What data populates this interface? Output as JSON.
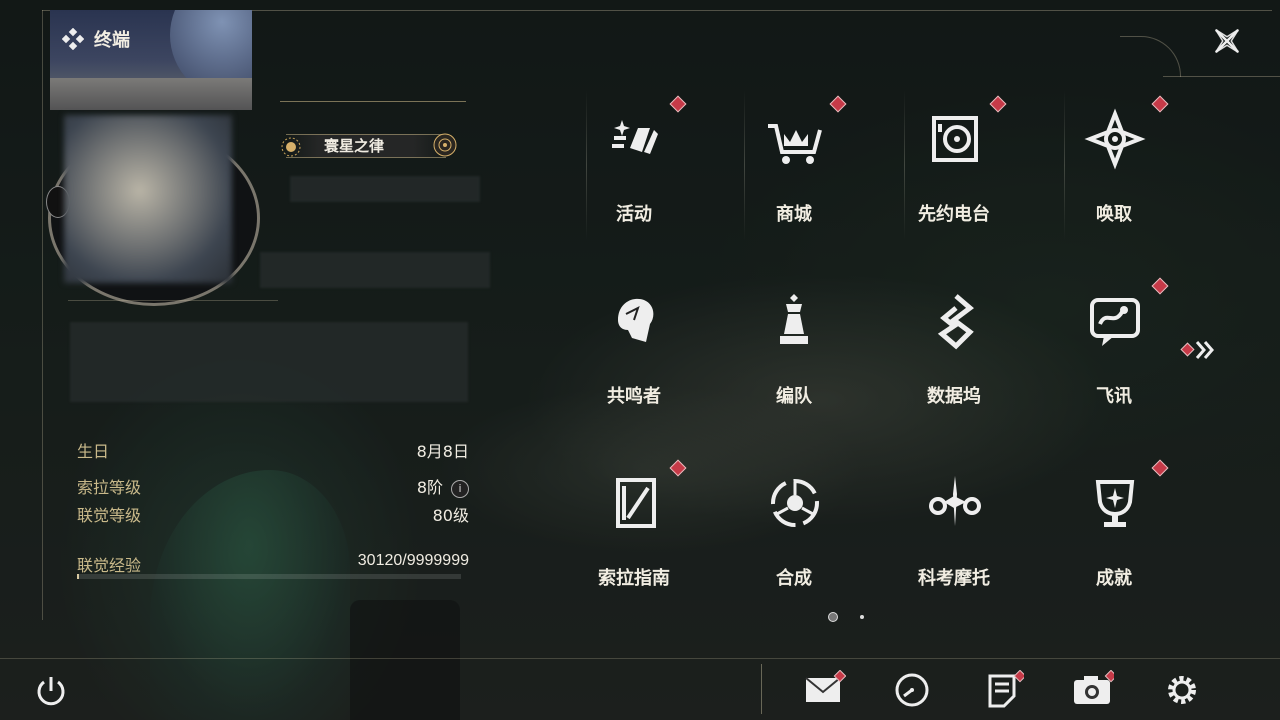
{
  "header": {
    "title": "终端"
  },
  "profile": {
    "title_badge": "寰星之律",
    "stats": [
      {
        "label": "生日",
        "value": "8月8日"
      },
      {
        "label": "索拉等级",
        "value": "8阶"
      },
      {
        "label": "联觉等级",
        "value": "80级"
      },
      {
        "label": "联觉经验",
        "value": "30120/9999999"
      }
    ],
    "exp_fraction": 0.003
  },
  "menu": {
    "items": [
      {
        "label": "活动",
        "icon": "activity-icon",
        "badge": true
      },
      {
        "label": "商城",
        "icon": "shop-cart-icon",
        "badge": true
      },
      {
        "label": "先约电台",
        "icon": "radio-icon",
        "badge": true
      },
      {
        "label": "唤取",
        "icon": "summon-icon",
        "badge": true
      },
      {
        "label": "共鸣者",
        "icon": "resonator-icon",
        "badge": false
      },
      {
        "label": "编队",
        "icon": "team-chess-icon",
        "badge": false
      },
      {
        "label": "数据坞",
        "icon": "data-dock-icon",
        "badge": false
      },
      {
        "label": "飞讯",
        "icon": "message-icon",
        "badge": true
      },
      {
        "label": "索拉指南",
        "icon": "guide-icon",
        "badge": true
      },
      {
        "label": "合成",
        "icon": "synthesis-icon",
        "badge": false
      },
      {
        "label": "科考摩托",
        "icon": "motorcycle-icon",
        "badge": false
      },
      {
        "label": "成就",
        "icon": "trophy-icon",
        "badge": true
      }
    ],
    "page_count": 2,
    "current_page": 1
  },
  "bottom_bar": {
    "buttons": [
      {
        "name": "mail-icon",
        "badge": true
      },
      {
        "name": "clock-icon",
        "badge": false
      },
      {
        "name": "notes-icon",
        "badge": true
      },
      {
        "name": "camera-icon",
        "badge": true
      },
      {
        "name": "settings-gear-icon",
        "badge": false
      }
    ]
  },
  "colors": {
    "badge": "#c63a48",
    "gold": "#c9b98a",
    "text": "#f1ede2"
  }
}
